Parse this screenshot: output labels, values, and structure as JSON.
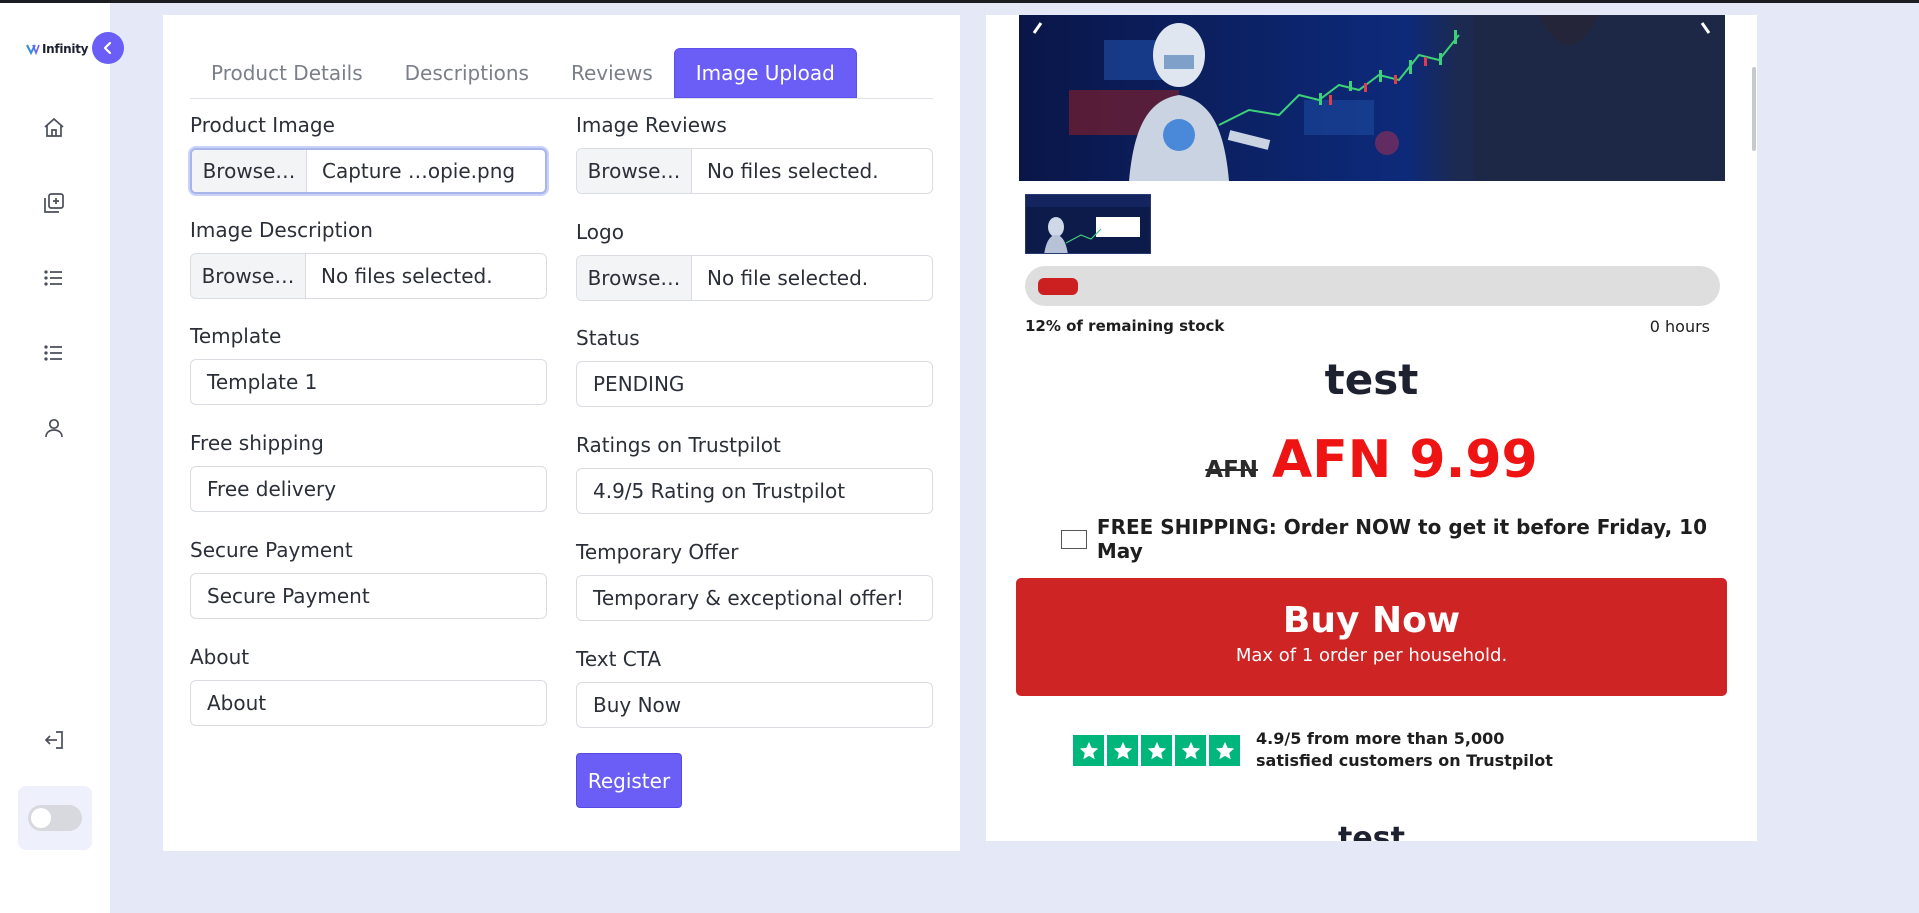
{
  "app": {
    "logo_text": "Infinity"
  },
  "sidebar": {
    "items": [
      {
        "icon": "home-icon"
      },
      {
        "icon": "add-product-icon"
      },
      {
        "icon": "list-icon"
      },
      {
        "icon": "list-icon"
      },
      {
        "icon": "user-icon"
      },
      {
        "icon": "logout-icon"
      }
    ],
    "theme_toggle": "off"
  },
  "tabs": [
    {
      "label": "Product Details",
      "active": false
    },
    {
      "label": "Descriptions",
      "active": false
    },
    {
      "label": "Reviews",
      "active": false
    },
    {
      "label": "Image Upload",
      "active": true
    }
  ],
  "form": {
    "product_image": {
      "label": "Product Image",
      "button": "Browse…",
      "file": "Capture …opie.png"
    },
    "image_reviews": {
      "label": "Image Reviews",
      "button": "Browse…",
      "file": "No files selected."
    },
    "image_description": {
      "label": "Image Description",
      "button": "Browse…",
      "file": "No files selected."
    },
    "logo": {
      "label": "Logo",
      "button": "Browse…",
      "file": "No file selected."
    },
    "template": {
      "label": "Template",
      "value": "Template 1"
    },
    "status": {
      "label": "Status",
      "value": "PENDING"
    },
    "free_shipping": {
      "label": "Free shipping",
      "value": "Free delivery"
    },
    "ratings": {
      "label": "Ratings on Trustpilot",
      "value": "4.9/5 Rating on Trustpilot"
    },
    "secure_payment": {
      "label": "Secure Payment",
      "value": "Secure Payment"
    },
    "temporary_offer": {
      "label": "Temporary Offer",
      "value": "Temporary & exceptional offer!"
    },
    "about": {
      "label": "About",
      "value": "About"
    },
    "text_cta": {
      "label": "Text CTA",
      "value": "Buy Now"
    },
    "register_label": "Register"
  },
  "preview": {
    "stock_text": "12% of remaining stock",
    "stock_fraction": 0.12,
    "hours_text": "0 hours",
    "title": "test",
    "old_price": "AFN",
    "new_price": "AFN 9.99",
    "shipping_text": "FREE SHIPPING: Order NOW to get it before Friday, 10 May",
    "buy_title": "Buy Now",
    "buy_subtitle": "Max of 1 order per household.",
    "rating_stars": 5,
    "trust_text": "4.9/5 from more than 5,000 satisfied customers on Trustpilot",
    "title_repeat": "test",
    "colors": {
      "accent": "#6a5ef6",
      "buy": "#cf2424",
      "price": "#ee1414",
      "trustpilot": "#00b67a"
    }
  }
}
